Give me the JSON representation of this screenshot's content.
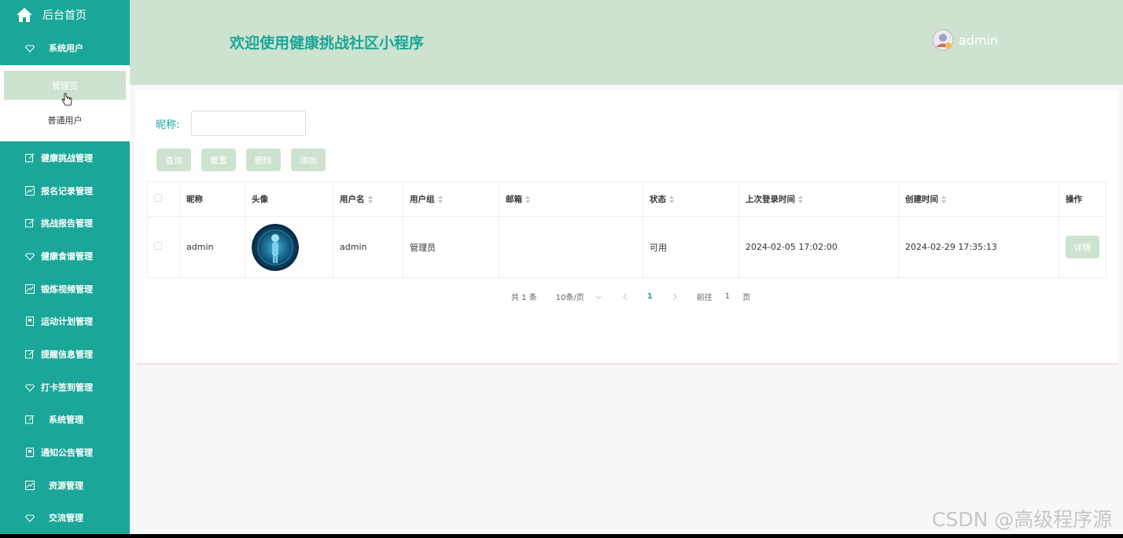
{
  "sidebar": {
    "brand": "后台首页",
    "items": [
      {
        "label": "系统用户",
        "icon": "diamond-icon"
      },
      {
        "label": "健康挑战管理",
        "icon": "edit-icon"
      },
      {
        "label": "报名记录管理",
        "icon": "chart-icon"
      },
      {
        "label": "挑战报告管理",
        "icon": "edit-icon"
      },
      {
        "label": "健康食谱管理",
        "icon": "diamond-icon"
      },
      {
        "label": "锻炼视频管理",
        "icon": "chart-icon"
      },
      {
        "label": "运动计划管理",
        "icon": "bookmark-icon"
      },
      {
        "label": "提醒信息管理",
        "icon": "edit-icon"
      },
      {
        "label": "打卡签到管理",
        "icon": "diamond-icon"
      },
      {
        "label": "系统管理",
        "icon": "edit-icon"
      },
      {
        "label": "通知公告管理",
        "icon": "bookmark-icon"
      },
      {
        "label": "资源管理",
        "icon": "chart-icon"
      },
      {
        "label": "交流管理",
        "icon": "diamond-icon"
      }
    ],
    "submenu": [
      "管理员",
      "普通用户"
    ]
  },
  "header": {
    "title": "欢迎使用健康挑战社区小程序",
    "user": "admin"
  },
  "search": {
    "label": "昵称:",
    "value": "",
    "placeholder": ""
  },
  "buttons": {
    "query": "查询",
    "reset": "重置",
    "delete": "删除",
    "add": "添加"
  },
  "table": {
    "headers": [
      "昵称",
      "头像",
      "用户名",
      "用户组",
      "邮箱",
      "状态",
      "上次登录时间",
      "创建时间",
      "操作"
    ],
    "rows": [
      {
        "nickname": "admin",
        "username": "admin",
        "group": "管理员",
        "email": "",
        "status": "可用",
        "last_login": "2024-02-05 17:02:00",
        "created": "2024-02-29 17:35:13",
        "action": "详情"
      }
    ]
  },
  "pager": {
    "total": "共 1 条",
    "size": "10条/页",
    "current": "1",
    "goto": "前往",
    "goto_value": "1",
    "page_unit": "页"
  },
  "watermark": "CSDN @高级程序源",
  "colors": {
    "sidebar": "#1aa699",
    "accent_light": "#cde3cf"
  }
}
